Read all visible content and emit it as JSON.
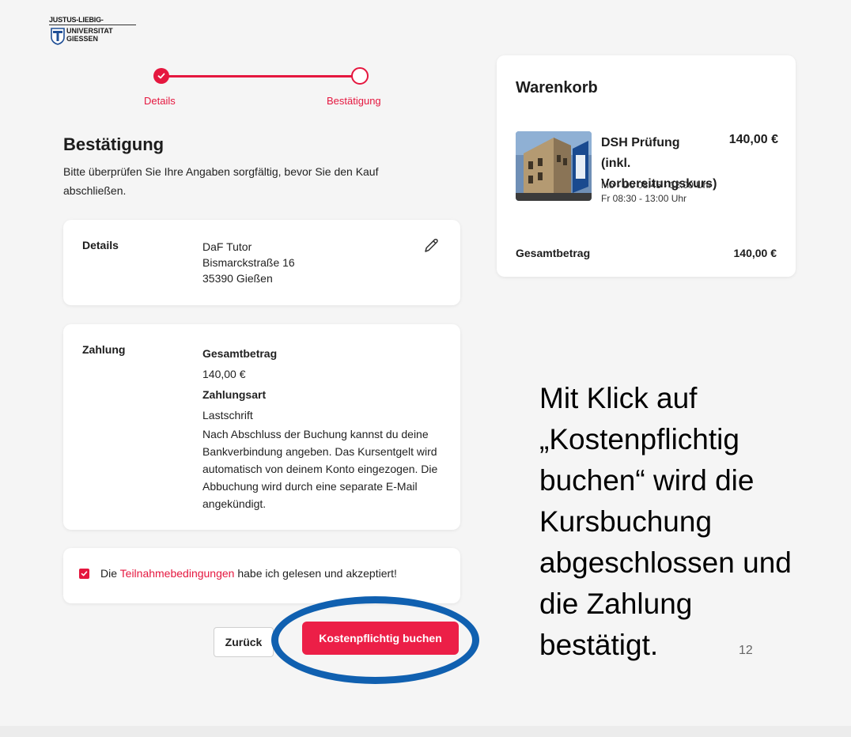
{
  "logo": {
    "line1": "JUSTUS-LIEBIG-",
    "line2a": "UNIVERSITAT",
    "line2b": "GIESSEN"
  },
  "stepper": {
    "step1": "Details",
    "step2": "Bestätigung",
    "accent": "#e5173f"
  },
  "confirmation": {
    "title": "Bestätigung",
    "intro": "Bitte überprüfen Sie Ihre Angaben sorgfältig, bevor Sie den Kauf abschließen."
  },
  "details": {
    "label": "Details",
    "name": "DaF Tutor",
    "street": "Bismarckstraße 16",
    "city": "35390 Gießen",
    "edit_icon": "pencil-icon"
  },
  "payment": {
    "label": "Zahlung",
    "total_label": "Gesamtbetrag",
    "total_value": "140,00 €",
    "method_label": "Zahlungsart",
    "method_value": "Lastschrift",
    "note": "Nach Abschluss der Buchung kannst du deine Bankverbindung angeben. Das Kursentgelt wird automatisch von deinem Konto eingezogen. Die Abbuchung wird durch eine separate E-Mail angekündigt."
  },
  "terms": {
    "prefix": "Die",
    "link": "Teilnahmebedingungen",
    "suffix": "habe ich gelesen und akzeptiert!",
    "checked": true
  },
  "buttons": {
    "back": "Zurück",
    "book": "Kostenpflichtig buchen",
    "book_color": "#ec1f47"
  },
  "cart": {
    "title": "Warenkorb",
    "item_name": "DSH Prüfung (inkl. Vorbereitungskurs)",
    "item_price": "140,00 €",
    "schedule1": "Mo - Do 08:45 - 12:00 Uhr",
    "schedule2": "Fr 08:30 - 13:00 Uhr",
    "total_label": "Gesamtbetrag",
    "total_value": "140,00 €"
  },
  "annotation": {
    "line1": "Mit Klick auf",
    "line2": "„Kostenpflichtig",
    "line3": "buchen“ wird die",
    "line4": "Kursbuchung",
    "line5": "abgeschlossen und",
    "line6": "die Zahlung",
    "line7": "bestätigt."
  },
  "highlight_color": "#1060b0",
  "page_number": "12"
}
